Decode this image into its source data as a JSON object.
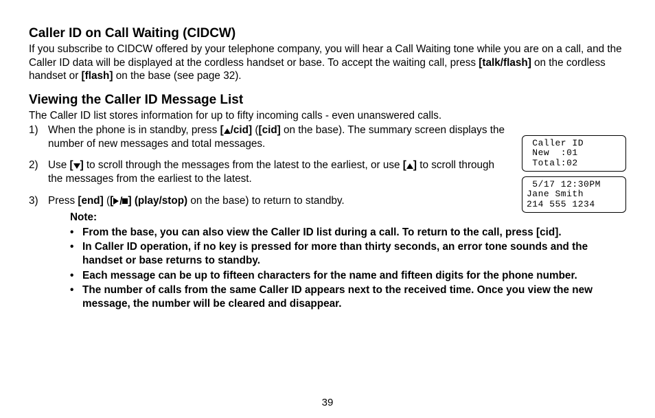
{
  "section1": {
    "heading": "Caller ID on Call Waiting (CIDCW)",
    "body_pre": "If you subscribe to CIDCW offered by your telephone company, you will hear a Call Waiting tone while you are on a call, and the Caller ID data will be displayed at the cordless handset or base. To accept the waiting call, press ",
    "key1": "[talk/flash]",
    "body_mid": " on the cordless handset or ",
    "key2": "[flash]",
    "body_post": " on the base (see page 32)."
  },
  "section2": {
    "heading": "Viewing the Caller ID Message List",
    "intro": "The Caller ID list stores information for up to fifty incoming calls - even unanswered calls.",
    "steps": [
      {
        "num": "1)",
        "pre": "When the phone is in standby, press ",
        "key_open": "[",
        "key_label": "/cid]",
        "paren_pre": " (",
        "key2": "[cid]",
        "paren_post": " on the base). The summary screen displays the number of new messages and total messages."
      },
      {
        "num": "2)",
        "pre": "Use ",
        "key_open1": "[",
        "key_close1": "]",
        "mid1": " to scroll through the messages from the latest to the earliest, or use ",
        "key_open2": "[",
        "key_close2": "]",
        "mid2": " to scroll through the messages from the earliest to the latest."
      },
      {
        "num": "3)",
        "pre": "Press ",
        "key1": "[end]",
        "paren_pre": " (",
        "key2_open": "[",
        "key2_close": "] (play/stop)",
        "paren_post": " on the base) to return to standby."
      }
    ],
    "note_label": "Note:",
    "notes": [
      "From the base, you can also view the Caller ID list during a call. To return to the call, press [cid].",
      "In Caller ID operation, if no key is pressed for more than thirty seconds, an error tone sounds and the handset or base returns to standby.",
      "Each message can be up to fifteen characters for the name and fifteen digits for the phone number.",
      "The number of calls from the same Caller ID appears next to the received time. Once you view the new message, the number will be cleared and disappear."
    ]
  },
  "lcd1": {
    "line1": " Caller ID",
    "line2": " New  :01",
    "line3": " Total:02"
  },
  "lcd2": {
    "line1": " 5/17 12:30PM",
    "line2": "Jane Smith",
    "line3": "214 555 1234"
  },
  "page_number": "39"
}
